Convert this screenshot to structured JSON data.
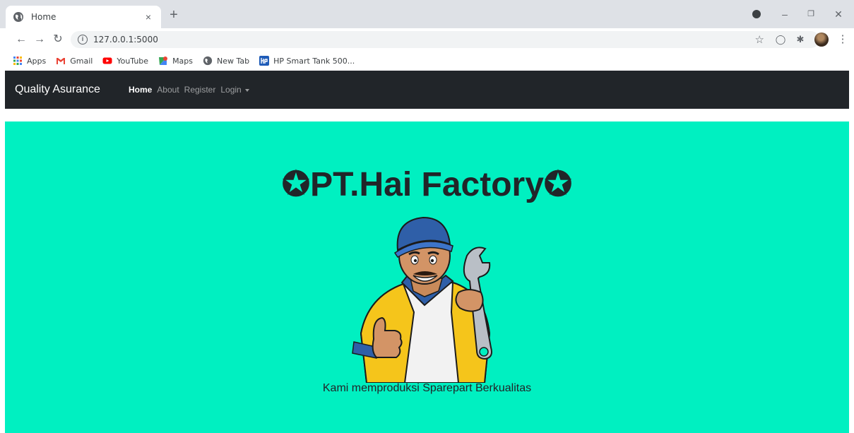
{
  "browser": {
    "tab_title": "Home",
    "tab_close": "×",
    "new_tab": "+",
    "url": "127.0.0.1:5000",
    "bookmarks": [
      {
        "label": "Apps",
        "icon": "apps-grid-icon"
      },
      {
        "label": "Gmail",
        "icon": "gmail-icon"
      },
      {
        "label": "YouTube",
        "icon": "youtube-icon"
      },
      {
        "label": "Maps",
        "icon": "maps-icon"
      },
      {
        "label": "New Tab",
        "icon": "globe-icon"
      },
      {
        "label": "HP Smart Tank 500...",
        "icon": "hp-icon"
      }
    ]
  },
  "navbar": {
    "brand": "Quality Asurance",
    "links": [
      {
        "label": "Home",
        "active": true
      },
      {
        "label": "About",
        "active": false
      },
      {
        "label": "Register",
        "active": false
      },
      {
        "label": "Login",
        "active": false,
        "dropdown": true
      }
    ]
  },
  "hero": {
    "title": "✪PT.Hai Factory✪",
    "tagline": "Kami memproduksi Sparepart Berkualitas",
    "image": "mechanic-mascot-with-wrench"
  },
  "colors": {
    "navbar_bg": "#212529",
    "hero_bg": "#00f0c1",
    "text_dark": "#212529"
  }
}
